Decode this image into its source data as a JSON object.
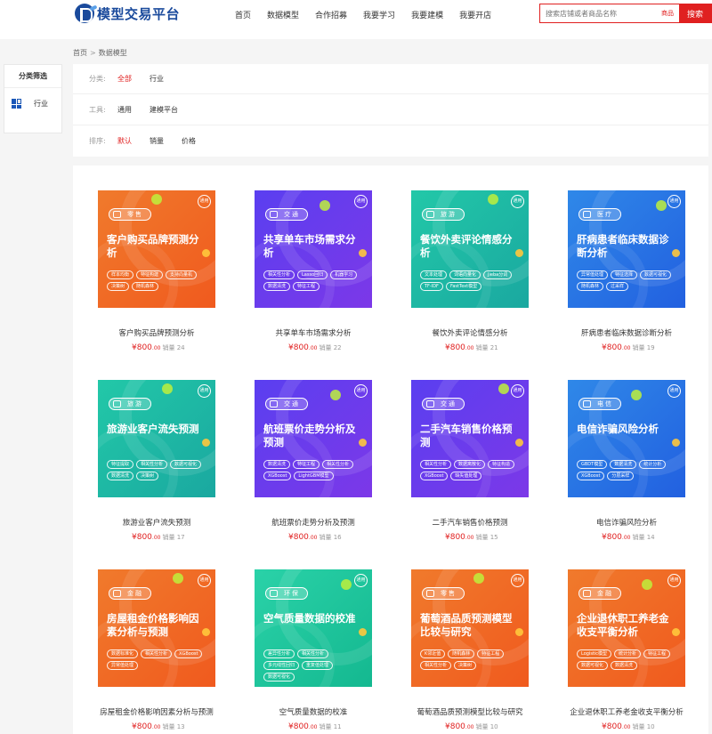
{
  "header": {
    "logo_text": "模型交易平台",
    "nav": [
      "首页",
      "数据模型",
      "合作招募",
      "我要学习",
      "我要建模",
      "我要开店"
    ],
    "search_placeholder": "搜索店铺或者商品名称",
    "search_scope": "商品",
    "search_button": "搜索"
  },
  "breadcrumb": {
    "home": "首页",
    "separator": ">",
    "current": "数据模型"
  },
  "sidebar": {
    "title": "分类筛选",
    "items": [
      {
        "label": "行业",
        "icon": "grid-icon"
      }
    ]
  },
  "filters": {
    "rows": [
      {
        "label": "分类:",
        "options": [
          "全部",
          "行业"
        ],
        "active": 0
      },
      {
        "label": "工具:",
        "options": [
          "通用",
          "建模平台"
        ],
        "active": -1
      },
      {
        "label": "排序:",
        "options": [
          "默认",
          "销量",
          "价格"
        ],
        "active": 0
      }
    ]
  },
  "colors": {
    "accent": "#e02020",
    "brand": "#1a4a9c"
  },
  "price_unit": "¥",
  "sales_label": "销量",
  "products": [
    {
      "name": "客户购买品牌预测分析",
      "thumb_title": "客户购买品牌预测分析",
      "category": "零售",
      "badge": "通用",
      "theme": "orange",
      "tags": [
        "样本均衡",
        "特征构建",
        "支持向量机",
        "决策树",
        "随机森林"
      ],
      "price": "800",
      "cents": ".00",
      "sales": "24"
    },
    {
      "name": "共享单车市场需求分析",
      "thumb_title": "共享单车市场需求分析",
      "category": "交通",
      "badge": "通用",
      "theme": "purple",
      "tags": [
        "相关性分析",
        "Lasso回归",
        "机器学习",
        "数据清洗",
        "特征工程"
      ],
      "price": "800",
      "cents": ".00",
      "sales": "22"
    },
    {
      "name": "餐饮外卖评论情感分析",
      "thumb_title": "餐饮外卖评论情感分析",
      "category": "旅游",
      "badge": "通用",
      "theme": "teal",
      "tags": [
        "文本处理",
        "词语向量化",
        "Jieba分词",
        "TF-IDF",
        "FastText模型"
      ],
      "price": "800",
      "cents": ".00",
      "sales": "21"
    },
    {
      "name": "肝病患者临床数据诊断分析",
      "thumb_title": "肝病患者临床数据诊断分析",
      "category": "医疗",
      "badge": "通用",
      "theme": "blue",
      "tags": [
        "异常值处理",
        "特征选择",
        "数据可视化",
        "随机森林",
        "过采样"
      ],
      "price": "800",
      "cents": ".00",
      "sales": "19"
    },
    {
      "name": "旅游业客户流失预测",
      "thumb_title": "旅游业客户流失预测",
      "category": "旅游",
      "badge": "通用",
      "theme": "teal",
      "tags": [
        "特征提取",
        "相关性分析",
        "数据可视化",
        "数据清洗",
        "决策树"
      ],
      "price": "800",
      "cents": ".00",
      "sales": "17"
    },
    {
      "name": "航班票价走势分析及预测",
      "thumb_title": "航班票价走势分析及预测",
      "category": "交通",
      "badge": "通用",
      "theme": "purple",
      "tags": [
        "数据清洗",
        "特征工程",
        "相关性分析",
        "XGBoost",
        "LightGBM模型"
      ],
      "price": "800",
      "cents": ".00",
      "sales": "16"
    },
    {
      "name": "二手汽车销售价格预测",
      "thumb_title": "二手汽车销售价格预测",
      "category": "交通",
      "badge": "通用",
      "theme": "purple",
      "tags": [
        "相关性分析",
        "数据离散化",
        "特征构造",
        "XGBoost",
        "缺失值处理"
      ],
      "price": "800",
      "cents": ".00",
      "sales": "15"
    },
    {
      "name": "电信诈骗风险分析",
      "thumb_title": "电信诈骗风险分析",
      "category": "电信",
      "badge": "通用",
      "theme": "blue",
      "tags": [
        "GBDT模型",
        "数据清洗",
        "统计分析",
        "XGBoost",
        "分层采样"
      ],
      "price": "800",
      "cents": ".00",
      "sales": "14"
    },
    {
      "name": "房屋租金价格影响因素分析与预测",
      "thumb_title": "房屋租金价格影响因素分析与预测",
      "category": "金融",
      "badge": "通用",
      "theme": "orange",
      "tags": [
        "数据标准化",
        "相关性分析",
        "XGBoost",
        "异常值处理"
      ],
      "price": "800",
      "cents": ".00",
      "sales": "13"
    },
    {
      "name": "空气质量数据的校准",
      "thumb_title": "空气质量数据的校准",
      "category": "环保",
      "badge": "通用",
      "theme": "green",
      "tags": [
        "差异性分析",
        "相关性分析",
        "多元线性回归",
        "重复值处理",
        "数据可视化"
      ],
      "price": "800",
      "cents": ".00",
      "sales": "11"
    },
    {
      "name": "葡萄酒品质预测模型比较与研究",
      "thumb_title": "葡萄酒品质预测模型比较与研究",
      "category": "零售",
      "badge": "通用",
      "theme": "orange",
      "tags": [
        "K邻近值",
        "随机森林",
        "特征工程",
        "相关性分析",
        "决策树"
      ],
      "price": "800",
      "cents": ".00",
      "sales": "10"
    },
    {
      "name": "企业退休职工养老金收支平衡分析",
      "thumb_title": "企业退休职工养老金收支平衡分析",
      "category": "金融",
      "badge": "通用",
      "theme": "orange",
      "tags": [
        "Logistic模型",
        "统计分析",
        "特征工程",
        "数据可视化",
        "数据清洗"
      ],
      "price": "800",
      "cents": ".00",
      "sales": "10"
    }
  ]
}
